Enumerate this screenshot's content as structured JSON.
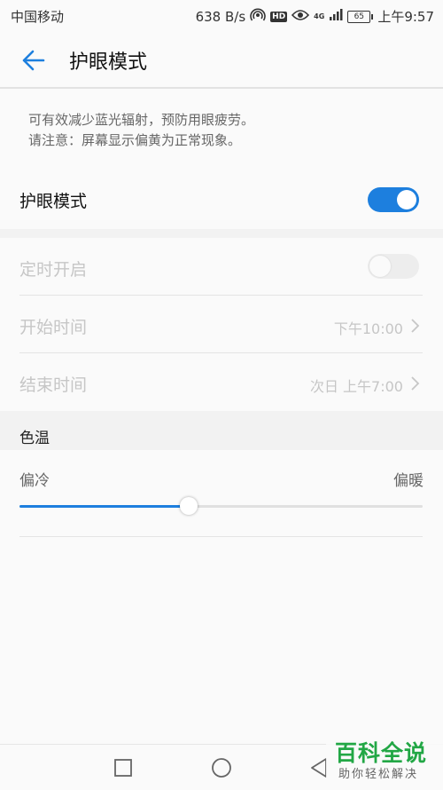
{
  "status_bar": {
    "carrier": "中国移动",
    "speed": "638 B/s",
    "hd": "HD",
    "network": "4G",
    "battery": "65",
    "time": "上午9:57"
  },
  "app_bar": {
    "title": "护眼模式"
  },
  "hint": {
    "line1": "可有效减少蓝光辐射，预防用眼疲劳。",
    "line2": "请注意：屏幕显示偏黄为正常现象。"
  },
  "eye_mode": {
    "label": "护眼模式",
    "enabled": true
  },
  "schedule": {
    "label": "定时开启",
    "enabled": false
  },
  "start_time": {
    "label": "开始时间",
    "value": "下午10:00"
  },
  "end_time": {
    "label": "结束时间",
    "value": "次日 上午7:00"
  },
  "color_temp": {
    "header": "色温",
    "cold_label": "偏冷",
    "warm_label": "偏暖",
    "value": 0.42
  },
  "watermark": {
    "main": "百科全说",
    "sub": "助你轻松解决"
  },
  "colors": {
    "accent": "#1d7fde",
    "disabled_text": "#c6c6c6",
    "watermark": "#22a745"
  },
  "icons": {
    "back": "back-arrow-icon",
    "chevron": "chevron-right-icon",
    "nav_recent": "square-icon",
    "nav_home": "circle-icon",
    "nav_back": "triangle-back-icon"
  }
}
